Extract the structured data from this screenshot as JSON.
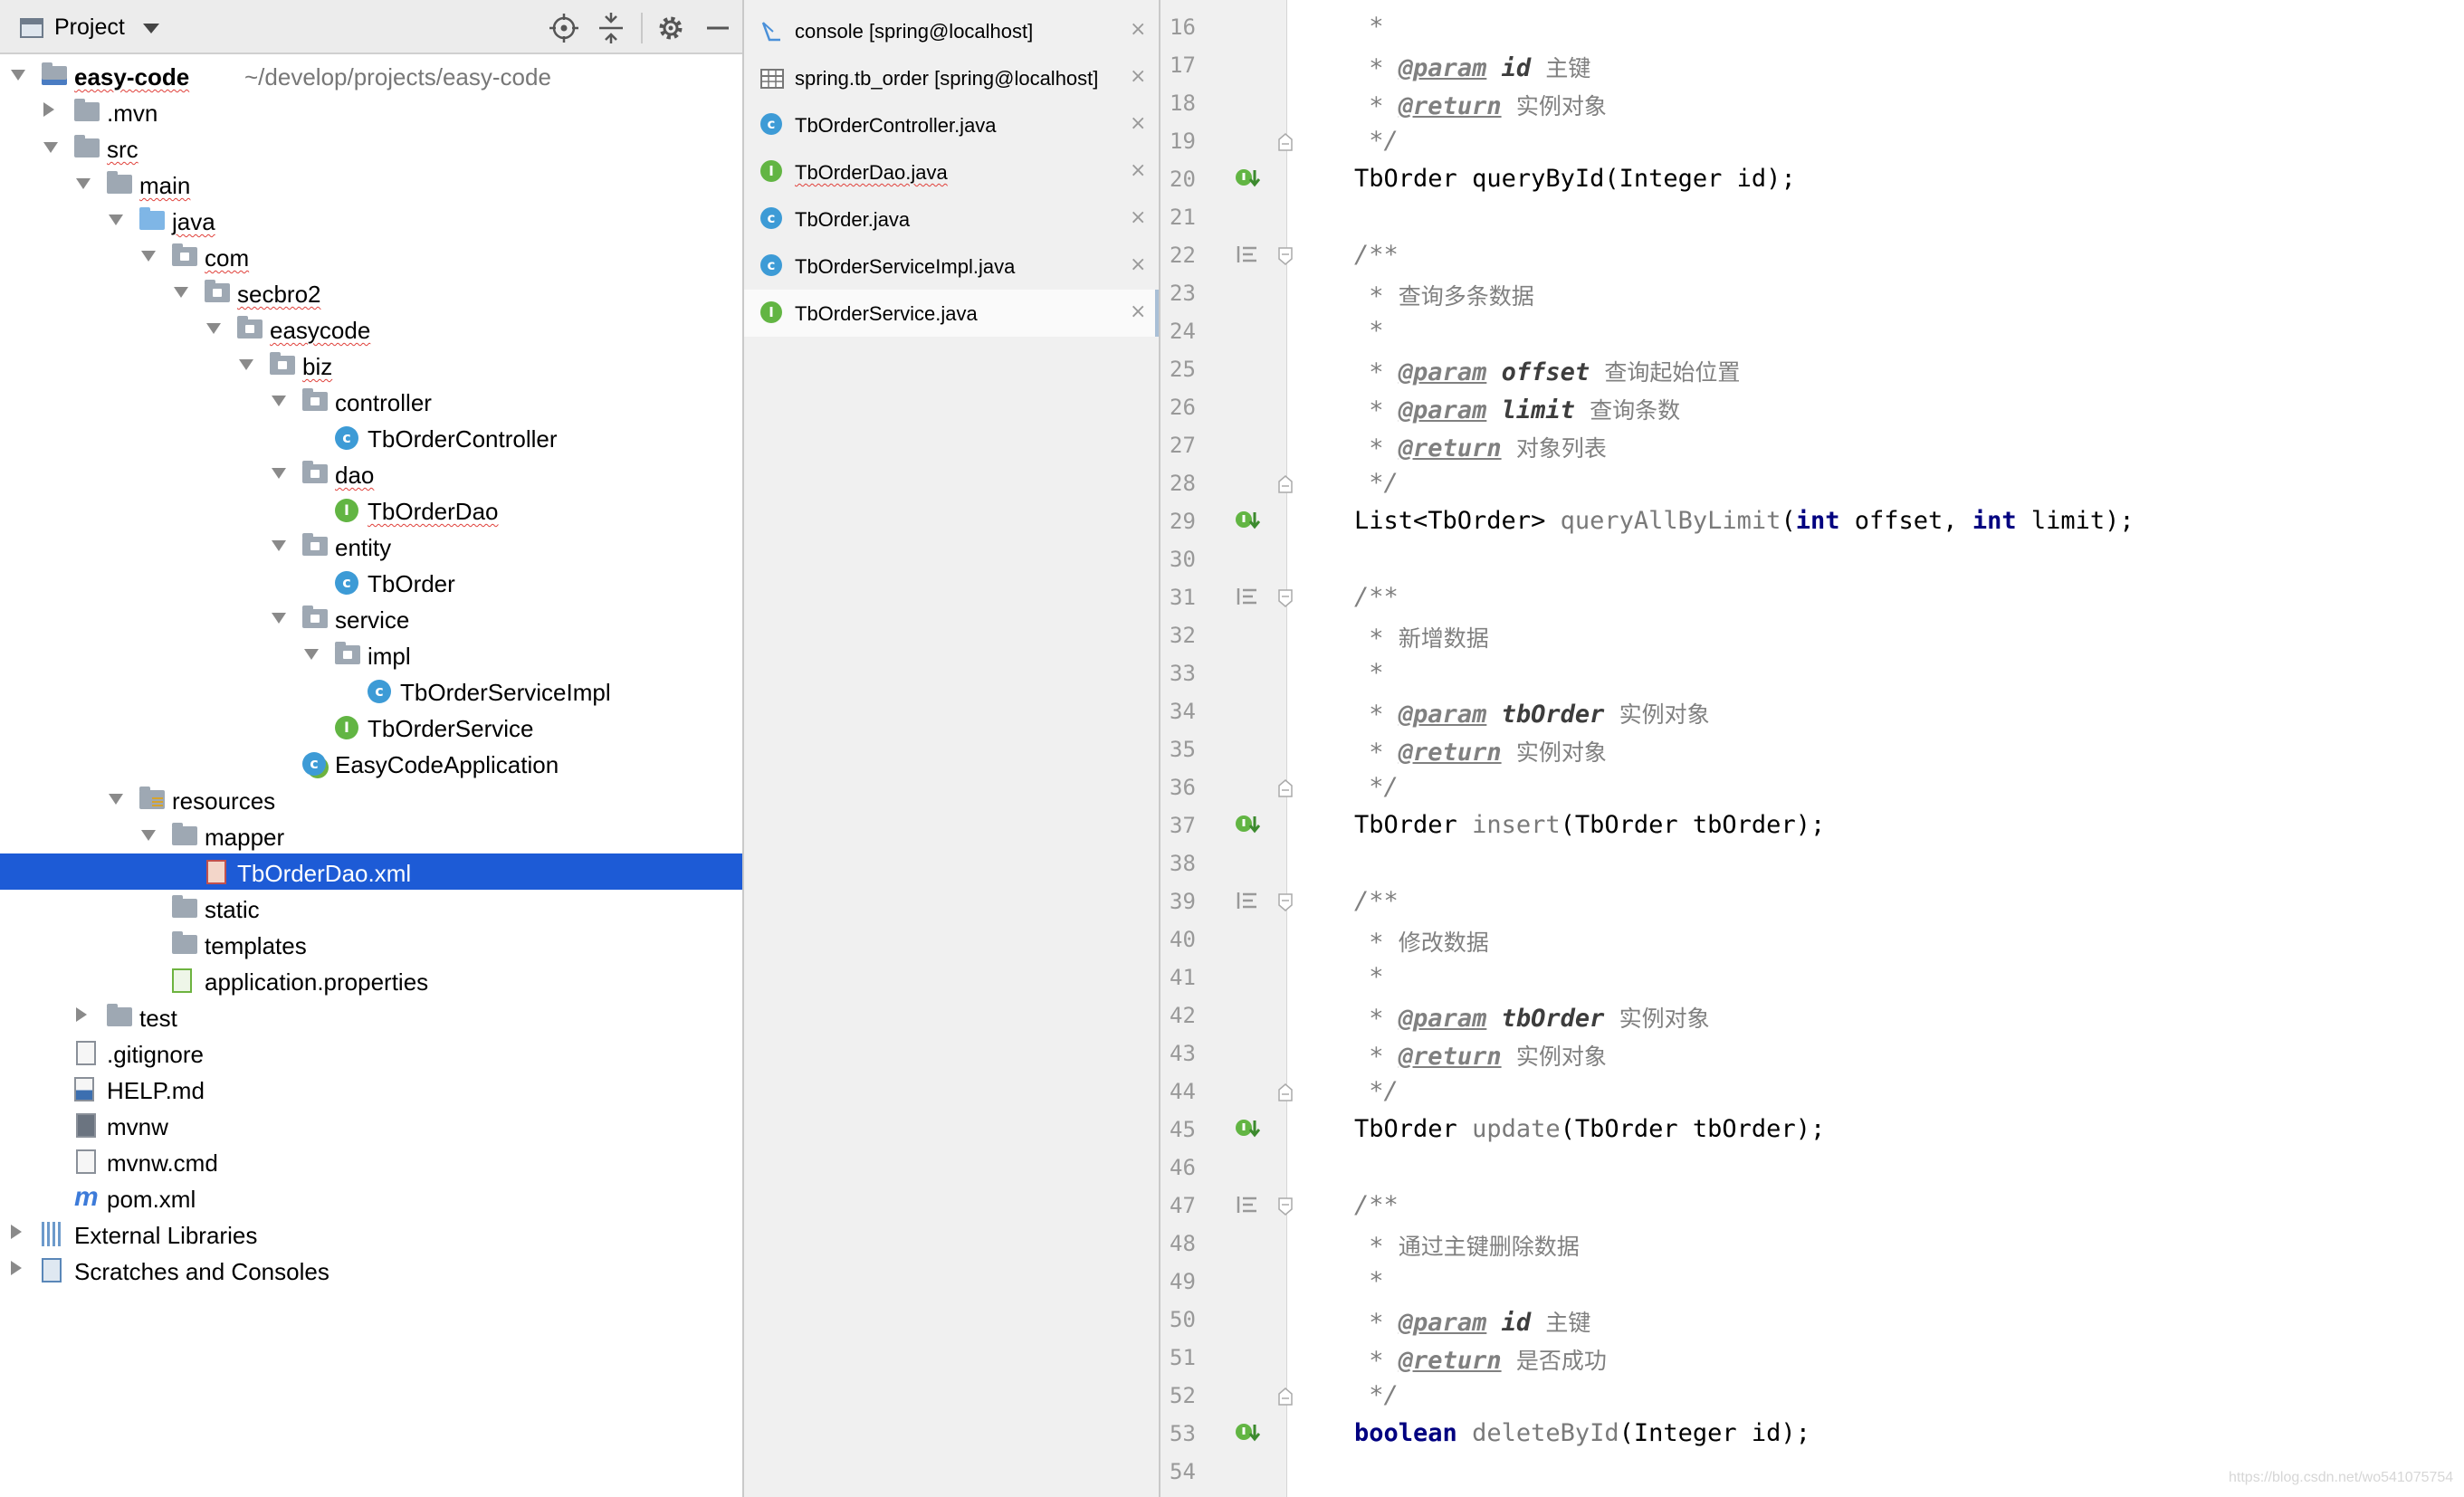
{
  "project_panel": {
    "title": "Project",
    "tree": [
      {
        "label": "easy-code",
        "path": "~/develop/projects/easy-code",
        "icon": "module-folder"
      },
      {
        "label": ".mvn",
        "icon": "folder"
      },
      {
        "label": "src",
        "icon": "folder"
      },
      {
        "label": "main",
        "icon": "folder"
      },
      {
        "label": "java",
        "icon": "source-folder"
      },
      {
        "label": "com",
        "icon": "package"
      },
      {
        "label": "secbro2",
        "icon": "package"
      },
      {
        "label": "easycode",
        "icon": "package"
      },
      {
        "label": "biz",
        "icon": "package"
      },
      {
        "label": "controller",
        "icon": "package"
      },
      {
        "label": "TbOrderController",
        "icon": "class-icon"
      },
      {
        "label": "dao",
        "icon": "package"
      },
      {
        "label": "TbOrderDao",
        "icon": "interface-icon"
      },
      {
        "label": "entity",
        "icon": "package"
      },
      {
        "label": "TbOrder",
        "icon": "class-icon"
      },
      {
        "label": "service",
        "icon": "package"
      },
      {
        "label": "impl",
        "icon": "package"
      },
      {
        "label": "TbOrderServiceImpl",
        "icon": "class-icon"
      },
      {
        "label": "TbOrderService",
        "icon": "interface-icon"
      },
      {
        "label": "EasyCodeApplication",
        "icon": "spring-boot-class-icon"
      },
      {
        "label": "resources",
        "icon": "resources-folder"
      },
      {
        "label": "mapper",
        "icon": "folder"
      },
      {
        "label": "TbOrderDao.xml",
        "icon": "xml-file-icon",
        "selected": true
      },
      {
        "label": "static",
        "icon": "folder"
      },
      {
        "label": "templates",
        "icon": "folder"
      },
      {
        "label": "application.properties",
        "icon": "properties-file-icon"
      },
      {
        "label": "test",
        "icon": "folder"
      },
      {
        "label": ".gitignore",
        "icon": "gitignore-file-icon"
      },
      {
        "label": "HELP.md",
        "icon": "markdown-file-icon"
      },
      {
        "label": "mvnw",
        "icon": "executable-file-icon"
      },
      {
        "label": "mvnw.cmd",
        "icon": "text-file-icon"
      },
      {
        "label": "pom.xml",
        "icon": "maven-icon"
      },
      {
        "label": "External Libraries",
        "icon": "libraries-icon"
      },
      {
        "label": "Scratches and Consoles",
        "icon": "scratches-icon"
      }
    ]
  },
  "tabs": [
    {
      "label": "console [spring@localhost]",
      "icon": "console-icon"
    },
    {
      "label": "spring.tb_order [spring@localhost]",
      "icon": "table-icon"
    },
    {
      "label": "TbOrderController.java",
      "icon": "class-icon"
    },
    {
      "label": "TbOrderDao.java",
      "icon": "interface-icon"
    },
    {
      "label": "TbOrder.java",
      "icon": "class-icon"
    },
    {
      "label": "TbOrderServiceImpl.java",
      "icon": "class-icon"
    },
    {
      "label": "TbOrderService.java",
      "icon": "interface-icon",
      "active": true
    }
  ],
  "tab_close_glyph": "×",
  "editor": {
    "line_numbers": [
      "16",
      "17",
      "18",
      "19",
      "20",
      "21",
      "22",
      "23",
      "24",
      "25",
      "26",
      "27",
      "28",
      "29",
      "30",
      "31",
      "32",
      "33",
      "34",
      "35",
      "36",
      "37",
      "38",
      "39",
      "40",
      "41",
      "42",
      "43",
      "44",
      "45",
      "46",
      "47",
      "48",
      "49",
      "50",
      "51",
      "52",
      "53",
      "54"
    ],
    "code": {
      "star": "*",
      "open": "/**",
      "close": "*/",
      "param_tag": "@param",
      "return_tag": "@return",
      "l17_param": "id",
      "l17_desc": "主键",
      "l18_desc": "实例对象",
      "l20_type": "TbOrder",
      "l20_method": "queryById",
      "l20_args": "(Integer id);",
      "l23_desc": "查询多条数据",
      "l25_param": "offset",
      "l25_desc": "查询起始位置",
      "l26_param": "limit",
      "l26_desc": "查询条数",
      "l27_desc": "对象列表",
      "l29_type": "List<TbOrder>",
      "l29_method": "queryAllByLimit",
      "l29_kw1": "int",
      "l29_arg1": "offset,",
      "l29_kw2": "int",
      "l29_arg2": "limit);",
      "l32_desc": "新增数据",
      "l34_param": "tbOrder",
      "l34_desc": "实例对象",
      "l35_desc": "实例对象",
      "l37_type": "TbOrder",
      "l37_method": "insert",
      "l37_args": "(TbOrder tbOrder);",
      "l40_desc": "修改数据",
      "l42_param": "tbOrder",
      "l42_desc": "实例对象",
      "l43_desc": "实例对象",
      "l45_type": "TbOrder",
      "l45_method": "update",
      "l45_args": "(TbOrder tbOrder);",
      "l48_desc": "通过主键删除数据",
      "l50_param": "id",
      "l50_desc": "主键",
      "l51_desc": "是否成功",
      "l53_kw": "boolean",
      "l53_method": "deleteById",
      "l53_args": "(Integer id);"
    }
  },
  "watermark": "https://blog.csdn.net/wo541075754"
}
